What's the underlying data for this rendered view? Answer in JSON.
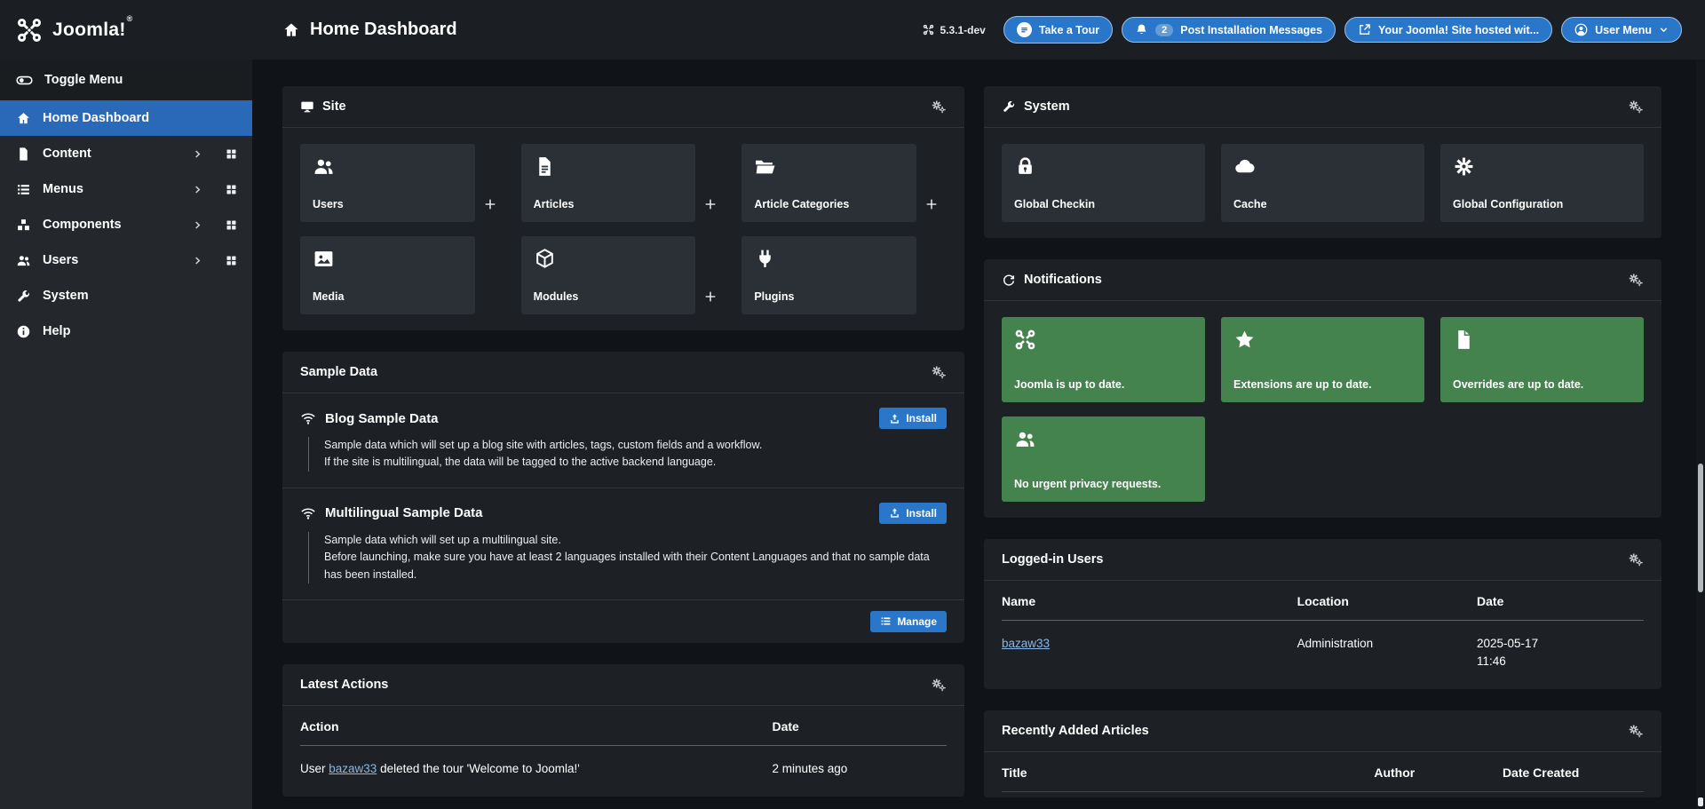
{
  "colors": {
    "accent": "#2a76c8",
    "sidebar_active": "#2a69b8",
    "success_tile": "#45834e",
    "link": "#8ab8e6",
    "card_bg": "#1d2125",
    "tile_bg": "#2b3036"
  },
  "header": {
    "logo": "Joomla!",
    "registered": "®",
    "page_title": "Home Dashboard",
    "version": "5.3.1-dev",
    "tour_button": "Take a Tour",
    "messages_button": "Post Installation Messages",
    "messages_count": "2",
    "hosted_button": "Your Joomla! Site hosted wit...",
    "user_menu_button": "User Menu"
  },
  "sidebar": {
    "toggle_label": "Toggle Menu",
    "items": [
      {
        "label": "Home Dashboard",
        "icon": "home-icon",
        "active": true
      },
      {
        "label": "Content",
        "icon": "file-icon",
        "expandable": true
      },
      {
        "label": "Menus",
        "icon": "list-icon",
        "expandable": true
      },
      {
        "label": "Components",
        "icon": "cubes-icon",
        "expandable": true
      },
      {
        "label": "Users",
        "icon": "users-icon",
        "expandable": true
      },
      {
        "label": "System",
        "icon": "wrench-icon",
        "expandable": false
      },
      {
        "label": "Help",
        "icon": "info-icon",
        "expandable": false
      }
    ]
  },
  "site_panel": {
    "title": "Site",
    "icon": "monitor-icon",
    "tiles": [
      {
        "label": "Users",
        "icon": "users-icon",
        "has_add": true
      },
      {
        "label": "Articles",
        "icon": "article-icon",
        "has_add": true
      },
      {
        "label": "Article Categories",
        "icon": "folder-open-icon",
        "has_add": true
      },
      {
        "label": "Media",
        "icon": "image-icon",
        "has_add": false
      },
      {
        "label": "Modules",
        "icon": "cube-icon",
        "has_add": true
      },
      {
        "label": "Plugins",
        "icon": "plug-icon",
        "has_add": false
      }
    ]
  },
  "sample_data": {
    "title": "Sample Data",
    "items": [
      {
        "heading": "Blog Sample Data",
        "icon": "wifi-icon",
        "line1": "Sample data which will set up a blog site with articles, tags, custom fields and a workflow.",
        "line2": "If the site is multilingual, the data will be tagged to the active backend language.",
        "button": "Install"
      },
      {
        "heading": "Multilingual Sample Data",
        "icon": "wifi-icon",
        "line1": "Sample data which will set up a multilingual site.",
        "line2": "Before launching, make sure you have at least 2 languages installed with their Content Languages and that no sample data has been installed.",
        "button": "Install"
      }
    ],
    "manage_button": "Manage"
  },
  "latest_actions": {
    "title": "Latest Actions",
    "columns": [
      "Action",
      "Date"
    ],
    "rows": [
      {
        "action_prefix": "User ",
        "action_link": "bazaw33",
        "action_suffix": " deleted the tour 'Welcome to Joomla!'",
        "date": "2 minutes ago"
      }
    ]
  },
  "system_panel": {
    "title": "System",
    "icon": "wrench-icon",
    "tiles": [
      {
        "label": "Global Checkin",
        "icon": "lock-icon"
      },
      {
        "label": "Cache",
        "icon": "cloud-icon"
      },
      {
        "label": "Global Configuration",
        "icon": "gear-icon"
      }
    ]
  },
  "notifications": {
    "title": "Notifications",
    "icon": "refresh-icon",
    "tiles": [
      {
        "label": "Joomla is up to date.",
        "icon": "joomla-icon"
      },
      {
        "label": "Extensions are up to date.",
        "icon": "star-icon"
      },
      {
        "label": "Overrides are up to date.",
        "icon": "file-icon"
      },
      {
        "label": "No urgent privacy requests.",
        "icon": "users-icon"
      }
    ]
  },
  "logged_in_users": {
    "title": "Logged-in Users",
    "columns": [
      "Name",
      "Location",
      "Date"
    ],
    "rows": [
      {
        "name": "bazaw33",
        "location": "Administration",
        "date": "2025-05-17",
        "time": "11:46"
      }
    ]
  },
  "recent_articles": {
    "title": "Recently Added Articles",
    "columns": [
      "Title",
      "Author",
      "Date Created"
    ]
  }
}
